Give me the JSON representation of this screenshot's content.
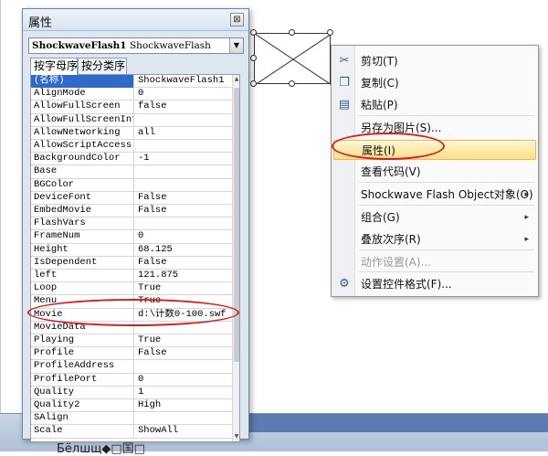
{
  "document": {
    "bottom_text": "Бёлшщ◆□国□"
  },
  "properties_window": {
    "title": "属性",
    "close_glyph": "⊠",
    "object_select": {
      "bold": "ShockwaveFlash1",
      "normal": "ShockwaveFlash"
    },
    "tabs": [
      {
        "label": "按字母序"
      },
      {
        "label": "按分类序"
      }
    ],
    "rows": [
      {
        "name": "(名称)",
        "value": "ShockwaveFlash1"
      },
      {
        "name": "AlignMode",
        "value": "0"
      },
      {
        "name": "AllowFullScreen",
        "value": "false"
      },
      {
        "name": "AllowFullScreenInte",
        "value": ""
      },
      {
        "name": "AllowNetworking",
        "value": "all"
      },
      {
        "name": "AllowScriptAccess",
        "value": ""
      },
      {
        "name": "BackgroundColor",
        "value": "-1"
      },
      {
        "name": "Base",
        "value": ""
      },
      {
        "name": "BGColor",
        "value": ""
      },
      {
        "name": "DeviceFont",
        "value": "False"
      },
      {
        "name": "EmbedMovie",
        "value": "False"
      },
      {
        "name": "FlashVars",
        "value": ""
      },
      {
        "name": "FrameNum",
        "value": "0"
      },
      {
        "name": "Height",
        "value": "68.125"
      },
      {
        "name": "IsDependent",
        "value": "False"
      },
      {
        "name": "left",
        "value": "121.875"
      },
      {
        "name": "Loop",
        "value": "True"
      },
      {
        "name": "Menu",
        "value": "True"
      },
      {
        "name": "Movie",
        "value": "d:\\计数0-100.swf"
      },
      {
        "name": "MovieData",
        "value": ""
      },
      {
        "name": "Playing",
        "value": "True"
      },
      {
        "name": "Profile",
        "value": "False"
      },
      {
        "name": "ProfileAddress",
        "value": ""
      },
      {
        "name": "ProfilePort",
        "value": "0"
      },
      {
        "name": "Quality",
        "value": "1"
      },
      {
        "name": "Quality2",
        "value": "High"
      },
      {
        "name": "SAlign",
        "value": ""
      },
      {
        "name": "Scale",
        "value": "ShowAll"
      }
    ]
  },
  "context_menu": {
    "items": [
      {
        "label": "剪切(T)",
        "icon": "scissors-icon",
        "glyph": "✂"
      },
      {
        "label": "复制(C)",
        "icon": "copy-icon",
        "glyph": "❐"
      },
      {
        "label": "粘贴(P)",
        "icon": "paste-icon",
        "glyph": "▤"
      },
      {
        "label": "另存为图片(S)...",
        "icon": "",
        "glyph": ""
      },
      {
        "label": "属性(I)",
        "icon": "",
        "glyph": ""
      },
      {
        "label": "查看代码(V)",
        "icon": "",
        "glyph": ""
      },
      {
        "label": "Shockwave Flash Object对象(O)",
        "icon": "",
        "glyph": "",
        "submenu": "▸"
      },
      {
        "label": "组合(G)",
        "icon": "",
        "glyph": "",
        "submenu": "▸"
      },
      {
        "label": "叠放次序(R)",
        "icon": "",
        "glyph": "",
        "submenu": "▸"
      },
      {
        "label": "动作设置(A)...",
        "icon": "",
        "glyph": ""
      },
      {
        "label": "设置控件格式(F)...",
        "icon": "format-control-icon",
        "glyph": "⚙"
      }
    ]
  },
  "colors": {
    "annotation": "#d81e1e",
    "selection": "#3169c6",
    "menu_highlight": "#ffdf86"
  }
}
